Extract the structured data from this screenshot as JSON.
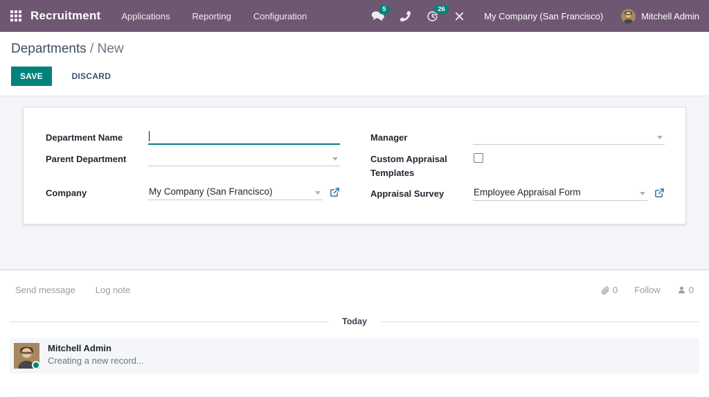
{
  "navbar": {
    "app_name": "Recruitment",
    "menus": [
      {
        "label": "Applications"
      },
      {
        "label": "Reporting"
      },
      {
        "label": "Configuration"
      }
    ],
    "messages_badge": "5",
    "activities_badge": "26",
    "company_name": "My Company (San Francisco)",
    "user_name": "Mitchell Admin"
  },
  "breadcrumb": {
    "parent": "Departments",
    "separator": " / ",
    "current": "New"
  },
  "control_panel": {
    "save_label": "SAVE",
    "discard_label": "DISCARD"
  },
  "form": {
    "department_name": {
      "label": "Department Name",
      "value": ""
    },
    "parent_department": {
      "label": "Parent Department",
      "value": ""
    },
    "company": {
      "label": "Company",
      "value": "My Company (San Francisco)"
    },
    "manager": {
      "label": "Manager",
      "value": ""
    },
    "custom_appraisal_templates": {
      "label": "Custom Appraisal Templates",
      "checked": false
    },
    "appraisal_survey": {
      "label": "Appraisal Survey",
      "value": "Employee Appraisal Form"
    }
  },
  "chatter": {
    "send_message_label": "Send message",
    "log_note_label": "Log note",
    "attachment_count": "0",
    "follow_label": "Follow",
    "follower_count": "0",
    "date_divider": "Today",
    "message": {
      "author": "Mitchell Admin",
      "body": "Creating a new record..."
    }
  },
  "colors": {
    "navbar_bg": "#6e5871",
    "badge_teal": "#00837b",
    "save_button": "#00827a",
    "focused_underline": "#0b7a8a",
    "online_dot": "#00837b",
    "external_link": "#2e7596"
  }
}
